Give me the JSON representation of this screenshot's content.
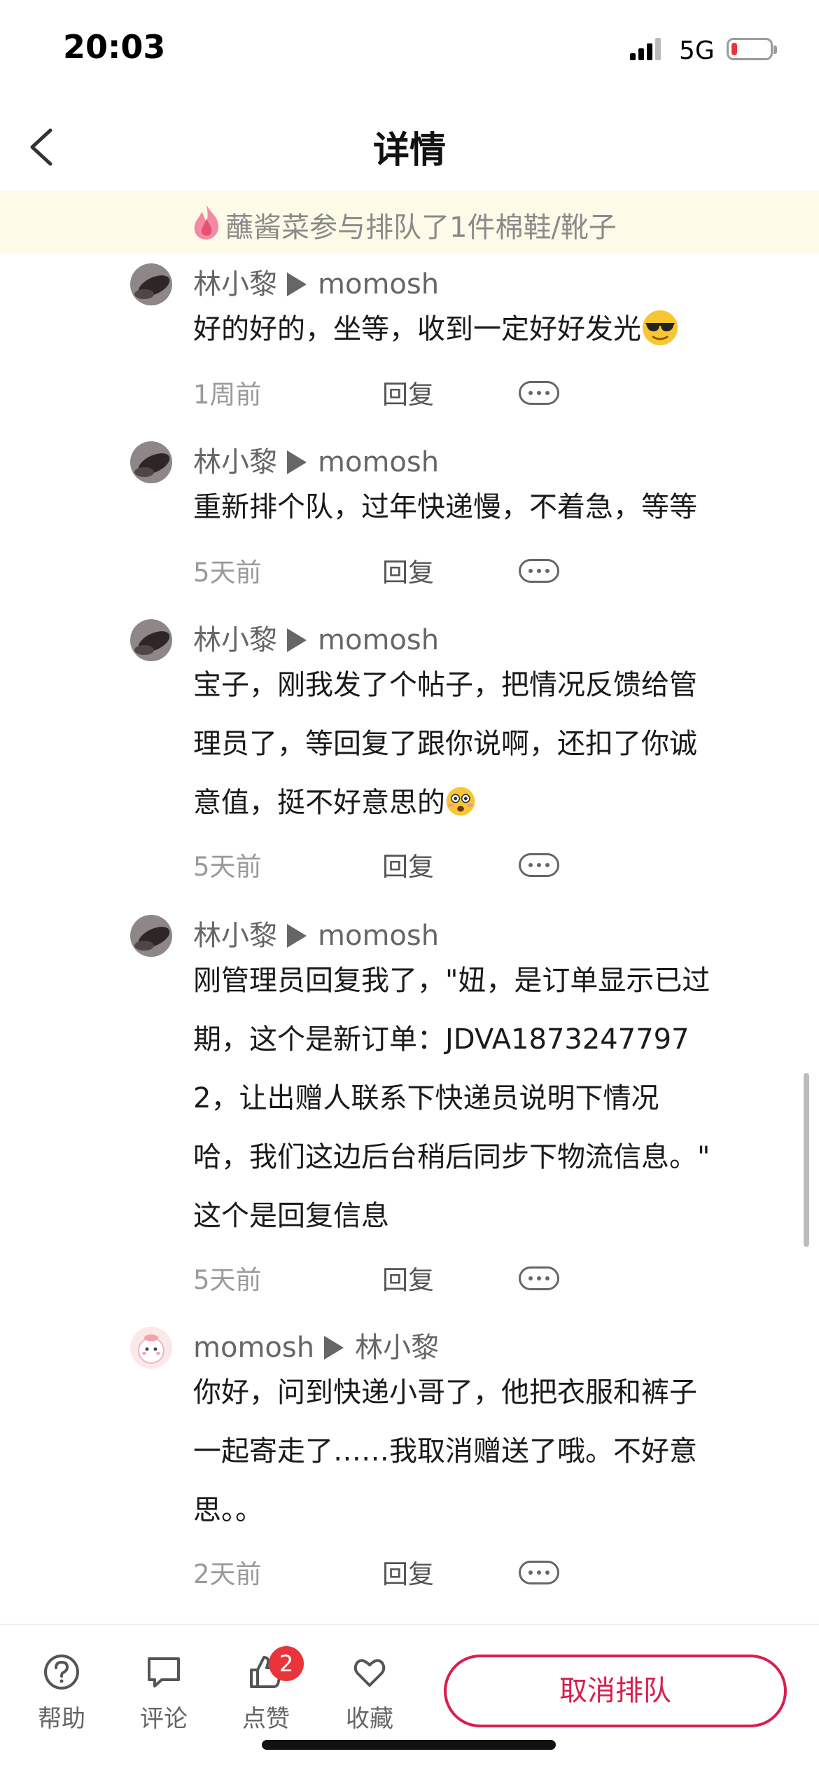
{
  "status": {
    "time": "20:03",
    "network": "5G",
    "battery_level": 0.15
  },
  "nav": {
    "title": "详情"
  },
  "banner": {
    "text": "蘸酱菜参与排队了1件棉鞋/靴子"
  },
  "comments": [
    {
      "author": "林小黎",
      "target": "momosh",
      "lines": [
        "好的好的，坐等，收到一定好好发光"
      ],
      "emoji": "sunglasses-emoji",
      "time": "1周前",
      "reply": "回复"
    },
    {
      "author": "林小黎",
      "target": "momosh",
      "lines": [
        "重新排个队，过年快递慢，不着急，等等"
      ],
      "time": "5天前",
      "reply": "回复"
    },
    {
      "author": "林小黎",
      "target": "momosh",
      "lines": [
        "宝子，刚我发了个帖子，把情况反馈给管",
        "理员了，等回复了跟你说啊，还扣了你诚",
        "意值，挺不好意思的"
      ],
      "emoji": "flushed-emoji",
      "time": "5天前",
      "reply": "回复"
    },
    {
      "author": "林小黎",
      "target": "momosh",
      "lines": [
        "刚管理员回复我了，\"妞，是订单显示已过",
        "期，这个是新订单：JDVA1873247797",
        "2，让出赠人联系下快递员说明下情况",
        "哈，我们这边后台稍后同步下物流信息。\"",
        "这个是回复信息"
      ],
      "time": "5天前",
      "reply": "回复"
    },
    {
      "author": "momosh",
      "target": "林小黎",
      "lines": [
        "你好，问到快递小哥了，他把衣服和裤子",
        "一起寄走了……我取消赠送了哦。不好意",
        "思。。"
      ],
      "time": "2天前",
      "reply": "回复"
    }
  ],
  "bottom": {
    "help": "帮助",
    "comment": "评论",
    "like": "点赞",
    "like_badge": "2",
    "favorite": "收藏",
    "cancel": "取消排队"
  }
}
